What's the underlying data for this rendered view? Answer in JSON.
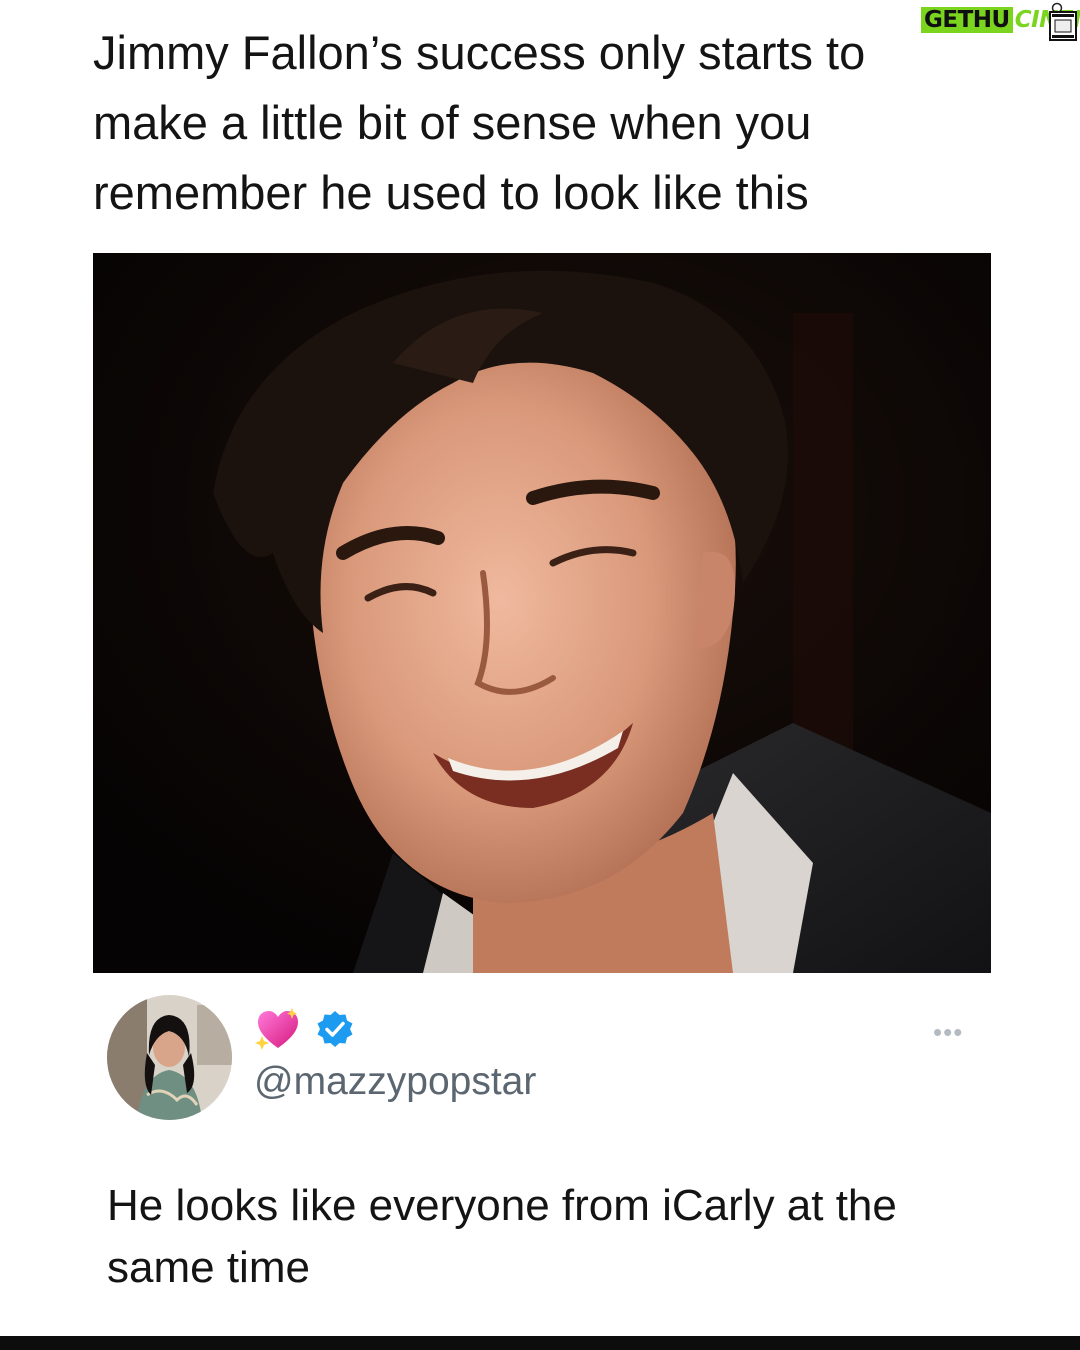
{
  "post": {
    "text": "Jimmy Fallon’s success only starts to make a little bit of sense when you remember he used to look like this"
  },
  "watermark": {
    "part1": "GETHU",
    "part2": "CINEMA",
    "accent_color": "#7bd51f"
  },
  "reply": {
    "handle": "@mazzypopstar",
    "name_emoji_icon": "sparkling-heart-icon",
    "verified_icon": "verified-badge-icon",
    "more_label": "•••",
    "text": "He looks like everyone from iCarly at the same time"
  }
}
